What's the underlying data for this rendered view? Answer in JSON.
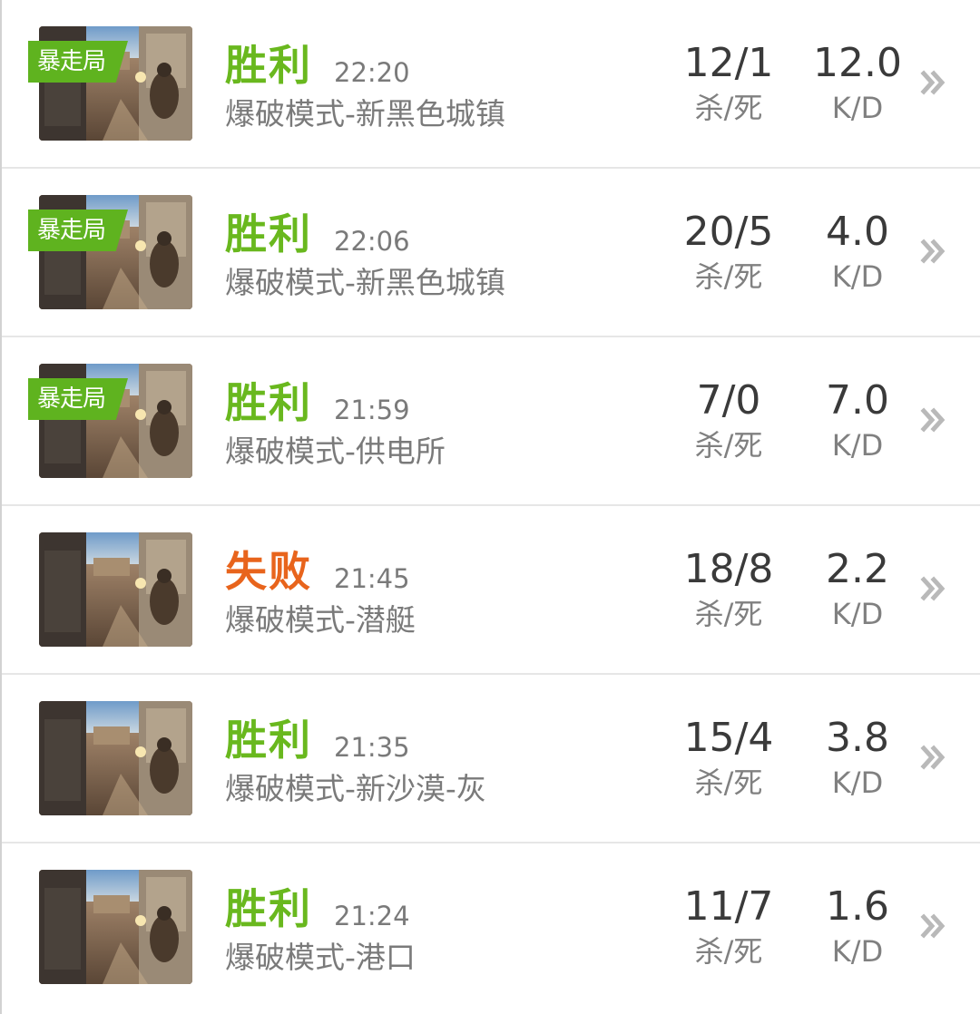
{
  "tag_label": "暴走局",
  "kd_label": "K/D",
  "ks_label": "杀/死",
  "colors": {
    "win": "#69b81e",
    "loss": "#e8641c",
    "tag": "#5fb31f"
  },
  "matches": [
    {
      "result": "胜利",
      "outcome": "win",
      "time": "22:20",
      "mode": "爆破模式-新黑色城镇",
      "kills_deaths": "12/1",
      "kd": "12.0",
      "tagged": true
    },
    {
      "result": "胜利",
      "outcome": "win",
      "time": "22:06",
      "mode": "爆破模式-新黑色城镇",
      "kills_deaths": "20/5",
      "kd": "4.0",
      "tagged": true
    },
    {
      "result": "胜利",
      "outcome": "win",
      "time": "21:59",
      "mode": "爆破模式-供电所",
      "kills_deaths": "7/0",
      "kd": "7.0",
      "tagged": true
    },
    {
      "result": "失败",
      "outcome": "loss",
      "time": "21:45",
      "mode": "爆破模式-潜艇",
      "kills_deaths": "18/8",
      "kd": "2.2",
      "tagged": false
    },
    {
      "result": "胜利",
      "outcome": "win",
      "time": "21:35",
      "mode": "爆破模式-新沙漠-灰",
      "kills_deaths": "15/4",
      "kd": "3.8",
      "tagged": false
    },
    {
      "result": "胜利",
      "outcome": "win",
      "time": "21:24",
      "mode": "爆破模式-港口",
      "kills_deaths": "11/7",
      "kd": "1.6",
      "tagged": false
    }
  ]
}
